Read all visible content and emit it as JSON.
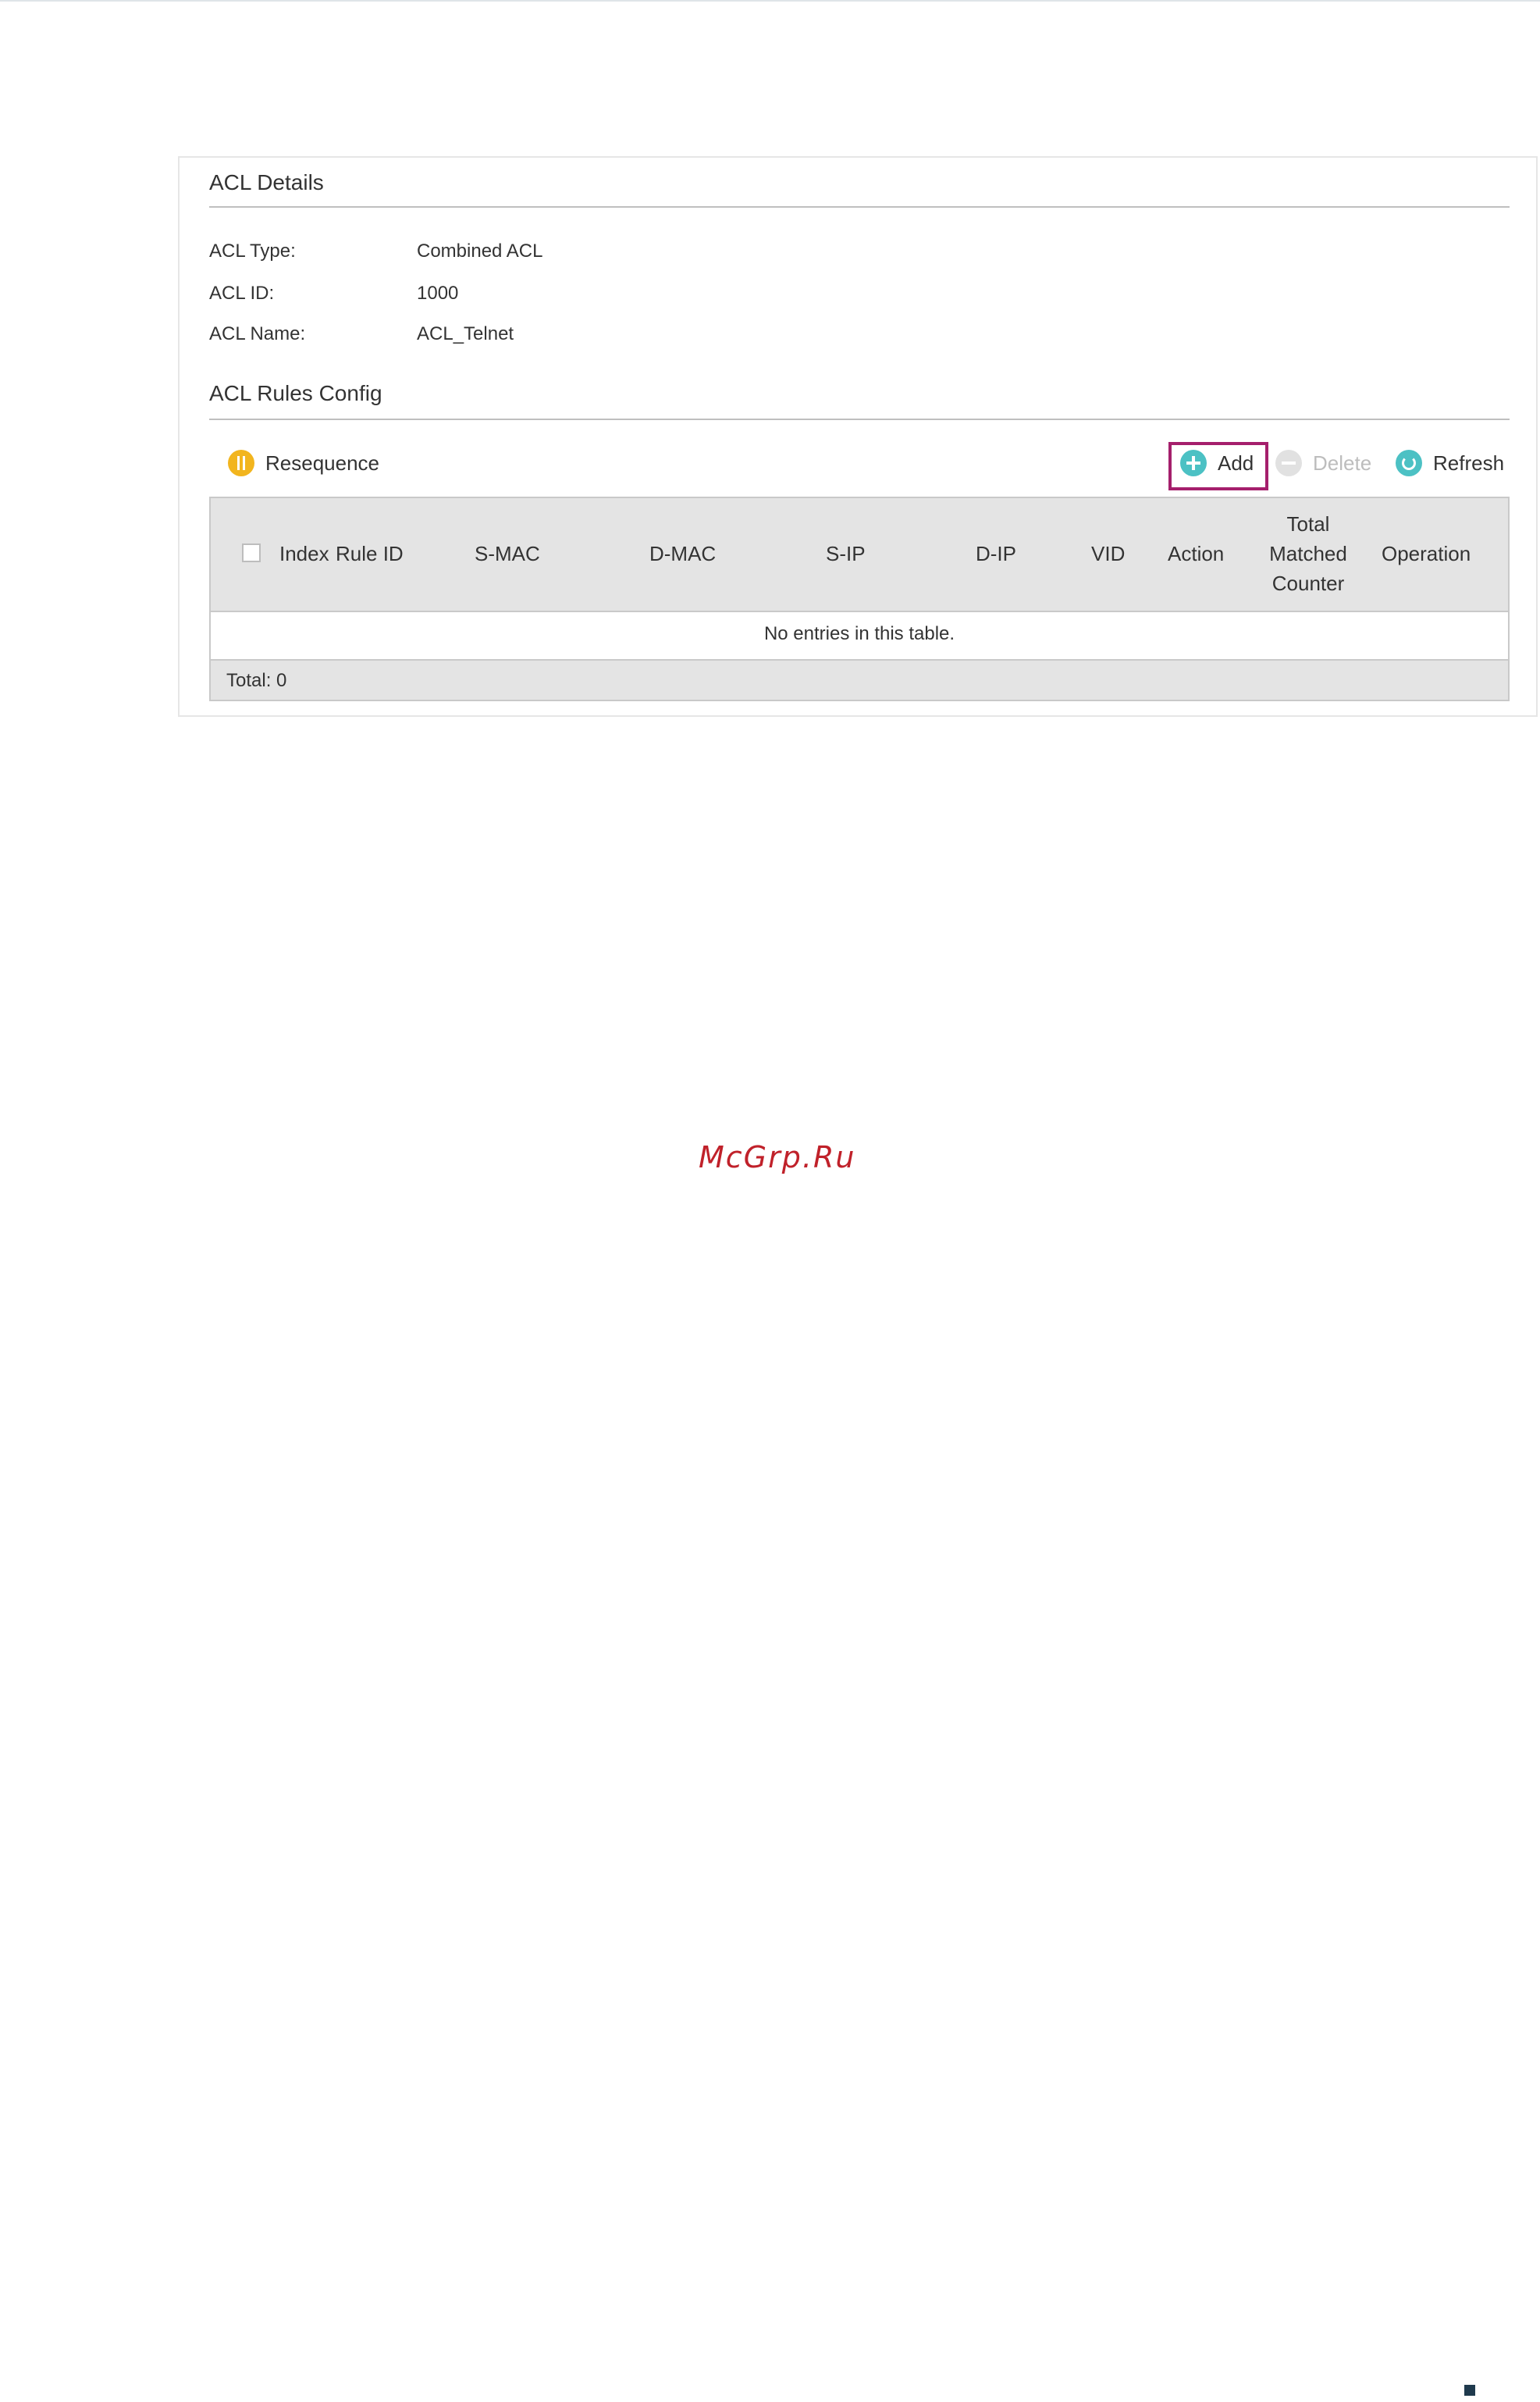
{
  "details": {
    "title": "ACL Details",
    "fields": [
      {
        "label": "ACL Type:",
        "value": "Combined ACL"
      },
      {
        "label": "ACL ID:",
        "value": "1000"
      },
      {
        "label": "ACL Name:",
        "value": "ACL_Telnet"
      }
    ]
  },
  "rules": {
    "title": "ACL Rules Config",
    "toolbar": {
      "resequence": "Resequence",
      "add": "Add",
      "delete": "Delete",
      "refresh": "Refresh"
    },
    "columns": [
      "Index",
      "Rule ID",
      "S-MAC",
      "D-MAC",
      "S-IP",
      "D-IP",
      "VID",
      "Action",
      "Total",
      "Matched",
      "Counter",
      "Operation"
    ],
    "empty_message": "No entries in this table.",
    "total": "Total: 0"
  },
  "watermark": "McGrp.Ru",
  "colors": {
    "accent": "#4cc1c4",
    "resequence": "#f2b51e",
    "highlight_box": "#a51f6c",
    "header_bg": "#e4e4e4"
  }
}
